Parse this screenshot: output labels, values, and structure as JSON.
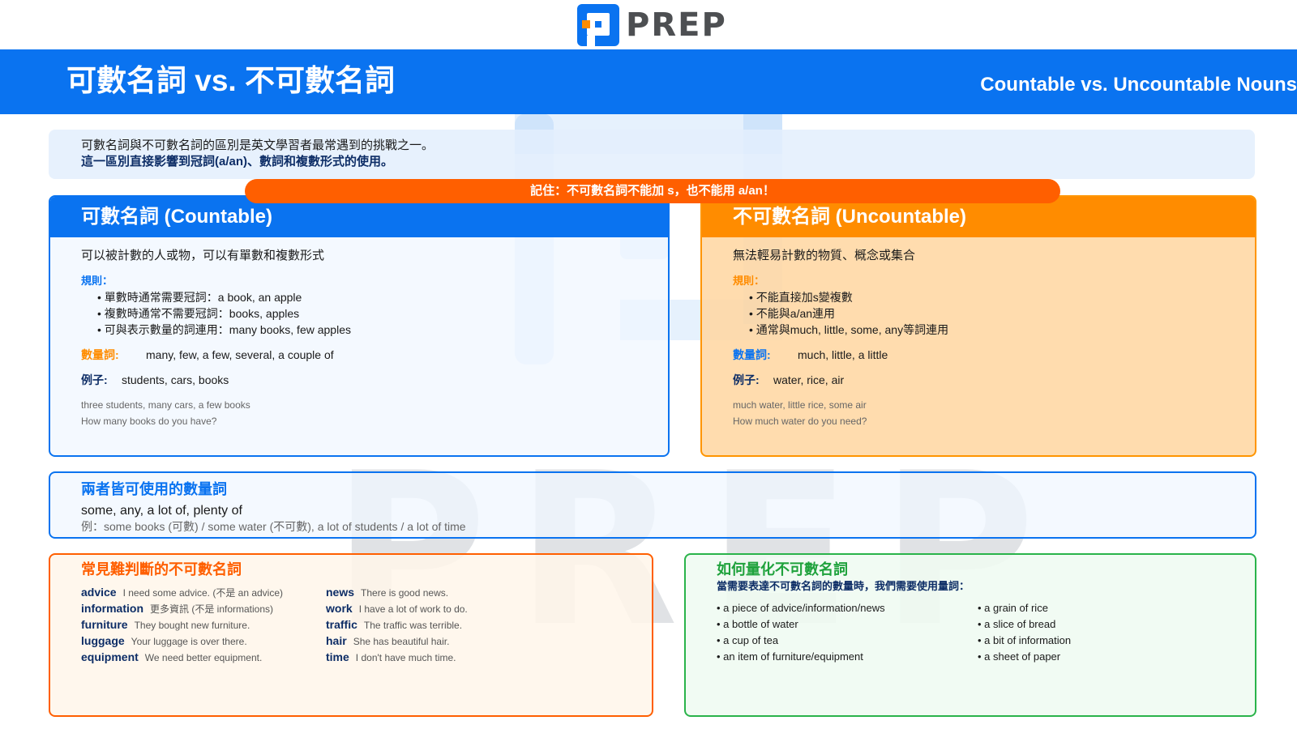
{
  "logo": {
    "text": "PREP"
  },
  "banner": {
    "title": "可數名詞 vs. 不可數名詞",
    "subtitle": "Countable vs. Uncountable Nouns"
  },
  "intro": {
    "line1": "可數名詞與不可數名詞的區別是英文學習者最常遇到的挑戰之一。",
    "line2": "這一區別直接影響到冠詞(a/an)、數詞和複數形式的使用。"
  },
  "reminder": "記住：不可數名詞不能加 s，也不能用 a/an！",
  "countable": {
    "title": "可數名詞 (Countable)",
    "description": "可以被計數的人或物，可以有單數和複數形式",
    "rules_label": "規則：",
    "rules": [
      "• 單數時通常需要冠詞：a book, an apple",
      "• 複數時通常不需要冠詞：books, apples",
      "• 可與表示數量的詞連用：many books, few apples"
    ],
    "quantifier_label": "數量詞:",
    "quantifiers": "many, few, a few, several, a couple of",
    "examples_label": "例子:",
    "examples": "students, cars, books",
    "sample1": "three students, many cars, a few books",
    "sample2": "How many books do you have?"
  },
  "uncountable": {
    "title": "不可數名詞 (Uncountable)",
    "description": "無法輕易計數的物質、概念或集合",
    "rules_label": "規則：",
    "rules": [
      "• 不能直接加s變複數",
      "• 不能與a/an連用",
      "• 通常與much, little, some, any等詞連用"
    ],
    "quantifier_label": "數量詞:",
    "quantifiers": "much, little, a little",
    "examples_label": "例子:",
    "examples": "water, rice, air",
    "sample1": "much water, little rice, some air",
    "sample2": "How much water do you need?"
  },
  "both": {
    "title": "兩者皆可使用的數量詞",
    "words": "some, any, a lot of, plenty of",
    "example": "例：some books (可數) / some water (不可數), a lot of students / a lot of time"
  },
  "common": {
    "title": "常見難判斷的不可數名詞",
    "left": [
      {
        "word": "advice",
        "example": "I need some advice. (不是 an advice)"
      },
      {
        "word": "information",
        "example": "更多資訊 (不是 informations)"
      },
      {
        "word": "furniture",
        "example": "They bought new furniture."
      },
      {
        "word": "luggage",
        "example": "Your luggage is over there."
      },
      {
        "word": "equipment",
        "example": "We need better equipment."
      }
    ],
    "right": [
      {
        "word": "news",
        "example": "There is good news."
      },
      {
        "word": "work",
        "example": "I have a lot of work to do."
      },
      {
        "word": "traffic",
        "example": "The traffic was terrible."
      },
      {
        "word": "hair",
        "example": "She has beautiful hair."
      },
      {
        "word": "time",
        "example": "I don't have much time."
      }
    ]
  },
  "quantify": {
    "title": "如何量化不可數名詞",
    "subtitle": "當需要表達不可數名詞的數量時，我們需要使用量詞：",
    "left": [
      "• a piece of advice/information/news",
      "• a bottle of water",
      "• a cup of tea",
      "• an item of furniture/equipment"
    ],
    "right": [
      "• a grain of rice",
      "• a slice of bread",
      "• a bit of information",
      "• a sheet of paper"
    ]
  },
  "watermark": {
    "text": "PREP"
  },
  "colors": {
    "primary_blue": "#0a73f0",
    "orange": "#ff8c00",
    "red_orange": "#ff5f00",
    "green": "#2ab34a",
    "navy": "#0d2d66"
  }
}
